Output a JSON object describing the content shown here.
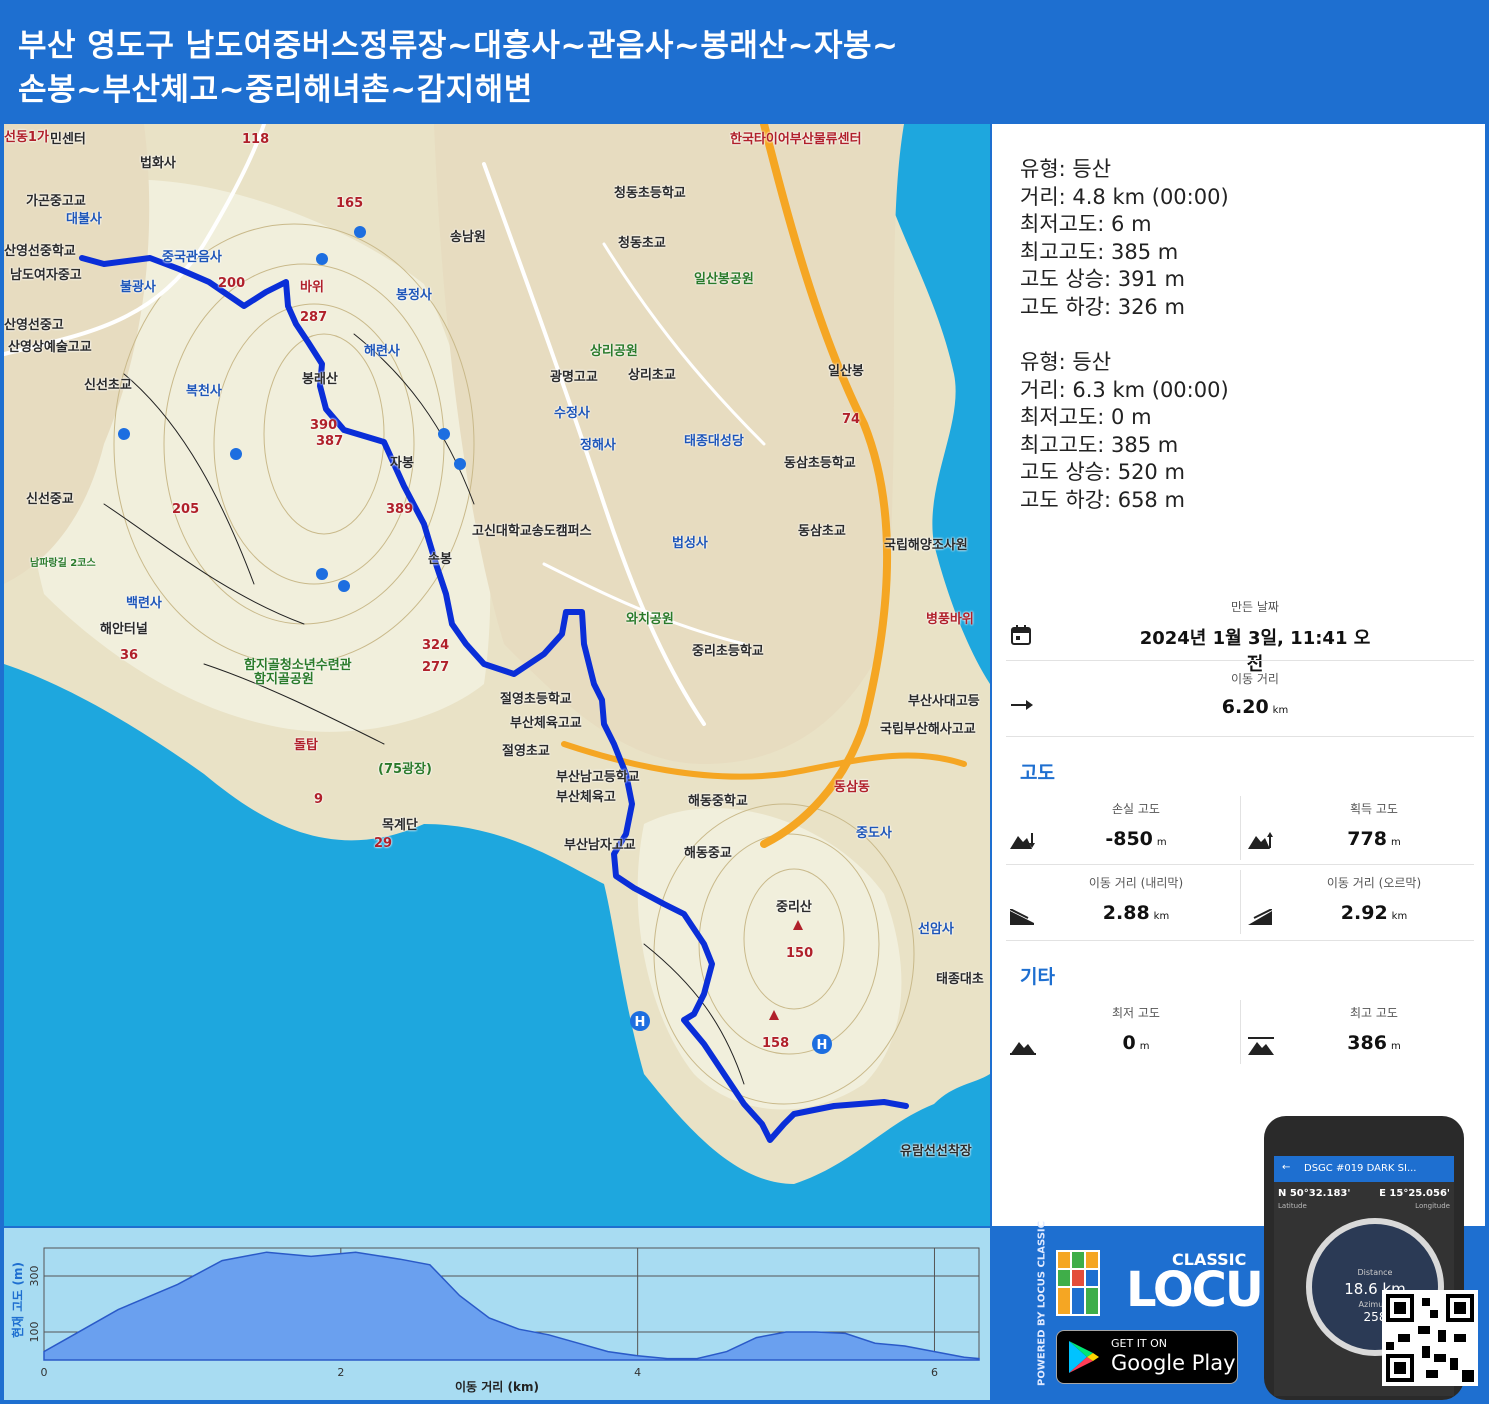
{
  "header": {
    "title_line1": "부산 영도구 남도여중버스정류장~대흥사~관음사~봉래산~자봉~",
    "title_line2": "손봉~부산체고~중리해녀촌~감지해변"
  },
  "map": {
    "labels": [
      {
        "text": "선동1가",
        "cls": "red-lbl"
      },
      {
        "text": "민센터",
        "cls": "dark-lbl"
      },
      {
        "text": "법화사",
        "cls": "dark-lbl"
      },
      {
        "text": "118",
        "cls": "red-lbl"
      },
      {
        "text": "가곤중고교",
        "cls": "dark-lbl"
      },
      {
        "text": "대불사",
        "cls": "blue-lbl"
      },
      {
        "text": "165",
        "cls": "red-lbl"
      },
      {
        "text": "산영선중학교",
        "cls": "dark-lbl"
      },
      {
        "text": "중국관음사",
        "cls": "blue-lbl"
      },
      {
        "text": "남도여자중고",
        "cls": "dark-lbl"
      },
      {
        "text": "불광사",
        "cls": "blue-lbl"
      },
      {
        "text": "200",
        "cls": "red-lbl"
      },
      {
        "text": "바위",
        "cls": "red-lbl"
      },
      {
        "text": "287",
        "cls": "red-lbl"
      },
      {
        "text": "산영선중고",
        "cls": "dark-lbl"
      },
      {
        "text": "산영상예술고교",
        "cls": "dark-lbl"
      },
      {
        "text": "해련사",
        "cls": "blue-lbl"
      },
      {
        "text": "봉정사",
        "cls": "blue-lbl"
      },
      {
        "text": "봉래산",
        "cls": "dark-lbl"
      },
      {
        "text": "신선초교",
        "cls": "dark-lbl"
      },
      {
        "text": "복천사",
        "cls": "blue-lbl"
      },
      {
        "text": "387",
        "cls": "red-lbl"
      },
      {
        "text": "390",
        "cls": "red-lbl"
      },
      {
        "text": "자봉",
        "cls": "dark-lbl"
      },
      {
        "text": "신선중교",
        "cls": "dark-lbl"
      },
      {
        "text": "205",
        "cls": "red-lbl"
      },
      {
        "text": "389",
        "cls": "red-lbl"
      },
      {
        "text": "손봉",
        "cls": "dark-lbl"
      },
      {
        "text": "백련사",
        "cls": "blue-lbl"
      },
      {
        "text": "해안터널",
        "cls": "dark-lbl"
      },
      {
        "text": "36",
        "cls": "red-lbl"
      },
      {
        "text": "324",
        "cls": "red-lbl"
      },
      {
        "text": "277",
        "cls": "red-lbl"
      },
      {
        "text": "함지골청소년수련관",
        "cls": "green-lbl"
      },
      {
        "text": "함지골공원",
        "cls": "green-lbl"
      },
      {
        "text": "돌탑",
        "cls": "red-lbl"
      },
      {
        "text": "(75광장)",
        "cls": "green-lbl"
      },
      {
        "text": "9",
        "cls": "red-lbl"
      },
      {
        "text": "목계단",
        "cls": "dark-lbl"
      },
      {
        "text": "29",
        "cls": "red-lbl"
      },
      {
        "text": "송남원",
        "cls": "dark-lbl"
      },
      {
        "text": "청동초등학교",
        "cls": "dark-lbl"
      },
      {
        "text": "청동초교",
        "cls": "dark-lbl"
      },
      {
        "text": "일산봉공원",
        "cls": "green-lbl"
      },
      {
        "text": "상리공원",
        "cls": "green-lbl"
      },
      {
        "text": "광명고교",
        "cls": "dark-lbl"
      },
      {
        "text": "상리초교",
        "cls": "dark-lbl"
      },
      {
        "text": "수정사",
        "cls": "blue-lbl"
      },
      {
        "text": "정해사",
        "cls": "blue-lbl"
      },
      {
        "text": "태종대성당",
        "cls": "blue-lbl"
      },
      {
        "text": "일산봉",
        "cls": "dark-lbl"
      },
      {
        "text": "74",
        "cls": "red-lbl"
      },
      {
        "text": "동삼초등학교",
        "cls": "dark-lbl"
      },
      {
        "text": "고신대학교송도캠퍼스",
        "cls": "dark-lbl"
      },
      {
        "text": "법성사",
        "cls": "blue-lbl"
      },
      {
        "text": "동삼초교",
        "cls": "dark-lbl"
      },
      {
        "text": "국립해양조사원",
        "cls": "dark-lbl"
      },
      {
        "text": "와치공원",
        "cls": "green-lbl"
      },
      {
        "text": "중리초등학교",
        "cls": "dark-lbl"
      },
      {
        "text": "병풍바위",
        "cls": "red-lbl"
      },
      {
        "text": "절영초등학교",
        "cls": "dark-lbl"
      },
      {
        "text": "부산체육고교",
        "cls": "dark-lbl"
      },
      {
        "text": "절영초교",
        "cls": "dark-lbl"
      },
      {
        "text": "부산남고등학교",
        "cls": "dark-lbl"
      },
      {
        "text": "부산체육고",
        "cls": "dark-lbl"
      },
      {
        "text": "해동중학교",
        "cls": "dark-lbl"
      },
      {
        "text": "부산사대고등",
        "cls": "dark-lbl"
      },
      {
        "text": "국립부산해사고교",
        "cls": "dark-lbl"
      },
      {
        "text": "동삼동",
        "cls": "red-lbl"
      },
      {
        "text": "중도사",
        "cls": "blue-lbl"
      },
      {
        "text": "부산남자고교",
        "cls": "dark-lbl"
      },
      {
        "text": "해동중교",
        "cls": "dark-lbl"
      },
      {
        "text": "중리산",
        "cls": "dark-lbl"
      },
      {
        "text": "선암사",
        "cls": "blue-lbl"
      },
      {
        "text": "150",
        "cls": "red-lbl"
      },
      {
        "text": "태종대초",
        "cls": "dark-lbl"
      },
      {
        "text": "158",
        "cls": "red-lbl"
      },
      {
        "text": "유람선선착장",
        "cls": "dark-lbl"
      },
      {
        "text": "한국타이어부산물류센터",
        "cls": "red-lbl"
      },
      {
        "text": "남파랑길 2코스",
        "cls": "green-lbl"
      }
    ]
  },
  "summary": {
    "segments": [
      {
        "type": "유형: 등산",
        "distance": "거리: 4.8 km (00:00)",
        "min_alt": "최저고도: 6 m",
        "max_alt": "최고고도: 385 m",
        "ascent": "고도 상승: 391 m",
        "descent": "고도 하강: 326 m"
      },
      {
        "type": "유형: 등산",
        "distance": "거리: 6.3 km (00:00)",
        "min_alt": "최저고도: 0 m",
        "max_alt": "최고고도: 385 m",
        "ascent": "고도 상승: 520 m",
        "descent": "고도 하강: 658 m"
      }
    ],
    "created_title": "만든 날짜",
    "created_value": "2024년 1월 3일, 11:41 오전",
    "distance_title": "이동 거리",
    "distance_value": "6.20",
    "distance_unit": "km",
    "elevation_section": "고도",
    "loss_title": "손실 고도",
    "loss_value": "-850",
    "loss_unit": "m",
    "gain_title": "획득 고도",
    "gain_value": "778",
    "gain_unit": "m",
    "down_title": "이동 거리 (내리막)",
    "down_value": "2.88",
    "down_unit": "km",
    "up_title": "이동 거리 (오르막)",
    "up_value": "2.92",
    "up_unit": "km",
    "other_section": "기타",
    "min_title": "최저 고도",
    "min_value": "0",
    "min_unit": "m",
    "max_title": "최고 고도",
    "max_value": "386",
    "max_unit": "m"
  },
  "elevation_chart": {
    "ylabel": "현재 고도 (m)",
    "xlabel": "이동 거리 (km)",
    "yticks": [
      "100",
      "300"
    ],
    "xticks": [
      "0",
      "2",
      "4",
      "6"
    ]
  },
  "chart_data": {
    "type": "area",
    "xlabel": "이동 거리 (km)",
    "ylabel": "현재 고도 (m)",
    "xlim": [
      0,
      6.3
    ],
    "ylim": [
      0,
      400
    ],
    "x": [
      0,
      0.2,
      0.5,
      0.9,
      1.2,
      1.5,
      1.8,
      2.1,
      2.4,
      2.6,
      2.8,
      3.0,
      3.2,
      3.4,
      3.6,
      3.8,
      4.0,
      4.2,
      4.4,
      4.6,
      4.8,
      5.0,
      5.2,
      5.4,
      5.6,
      5.8,
      6.0,
      6.2,
      6.3
    ],
    "y": [
      30,
      90,
      180,
      270,
      355,
      385,
      370,
      385,
      360,
      340,
      230,
      150,
      110,
      90,
      60,
      30,
      15,
      5,
      5,
      30,
      80,
      100,
      100,
      95,
      60,
      50,
      30,
      10,
      5
    ],
    "color": "#3f7de0"
  },
  "promo": {
    "powered": "POWERED BY LOCUS CLASSIC",
    "classic": "CLASSIC",
    "brand": "LOCUS",
    "gp_small": "GET IT ON",
    "gp_big": "Google Play",
    "phone_title": "DSGC #019 DARK SI...",
    "phone_lat": "N 50°32.183'",
    "phone_lon": "E 15°25.056'",
    "phone_lat_label": "Latitude",
    "phone_lon_label": "Longitude",
    "phone_dist_label": "Distance",
    "phone_dist": "18.6 km",
    "phone_azi_label": "Azimuth",
    "phone_azi": "258"
  }
}
